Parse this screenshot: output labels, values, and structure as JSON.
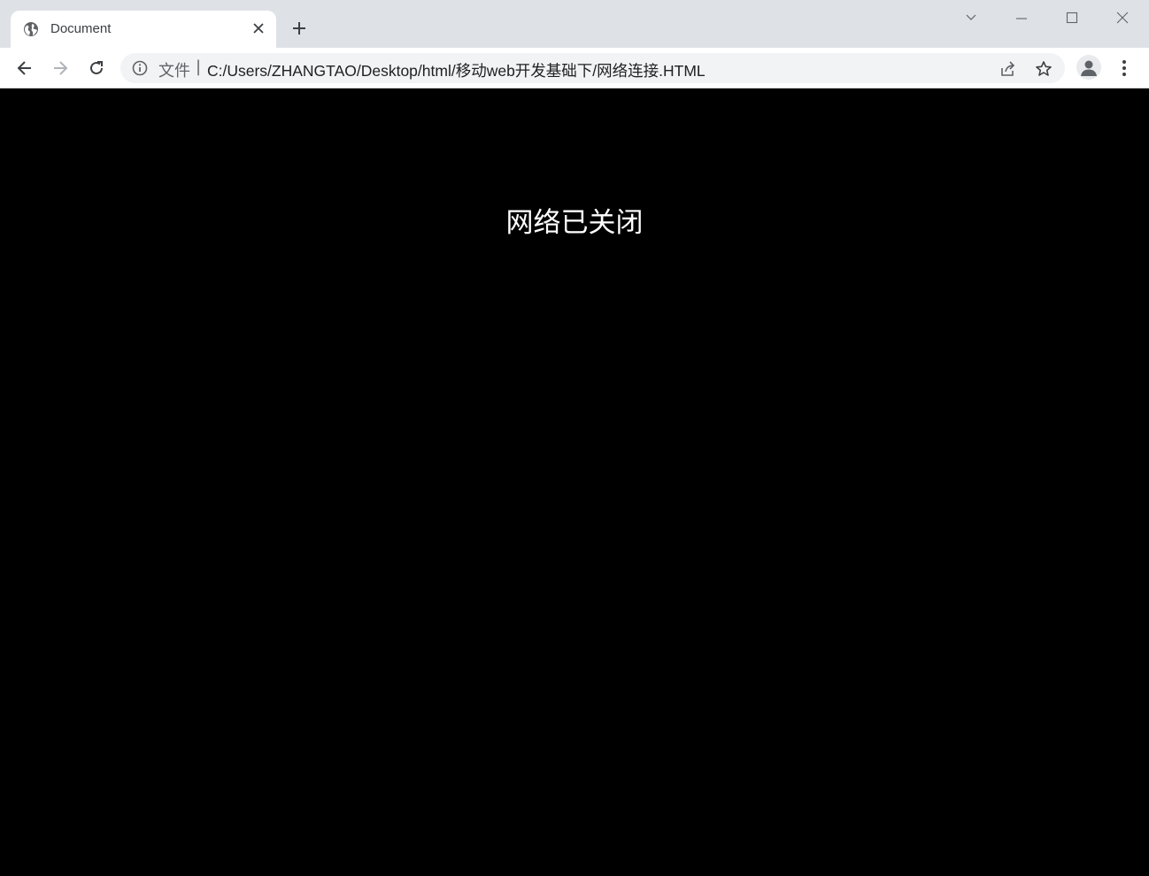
{
  "tab": {
    "title": "Document",
    "favicon": "globe-icon"
  },
  "toolbar": {
    "scheme_label": "文件",
    "separator": "|",
    "url": "C:/Users/ZHANGTAO/Desktop/html/移动web开发基础下/网络连接.HTML"
  },
  "icons": {
    "back": "arrow-left-icon",
    "forward": "arrow-right-icon",
    "reload": "reload-icon",
    "info": "info-icon",
    "share": "share-icon",
    "bookmark": "star-icon",
    "profile": "avatar-icon",
    "menu": "kebab-menu-icon",
    "new_tab": "plus-icon",
    "tab_close": "close-icon",
    "tab_search": "chevron-down-icon",
    "minimize": "minimize-icon",
    "maximize": "maximize-icon",
    "close_window": "close-icon"
  },
  "page": {
    "message": "网络已关闭"
  },
  "colors": {
    "tabbar_bg": "#dee1e6",
    "page_bg": "#000000",
    "message_color": "#ffffff"
  }
}
